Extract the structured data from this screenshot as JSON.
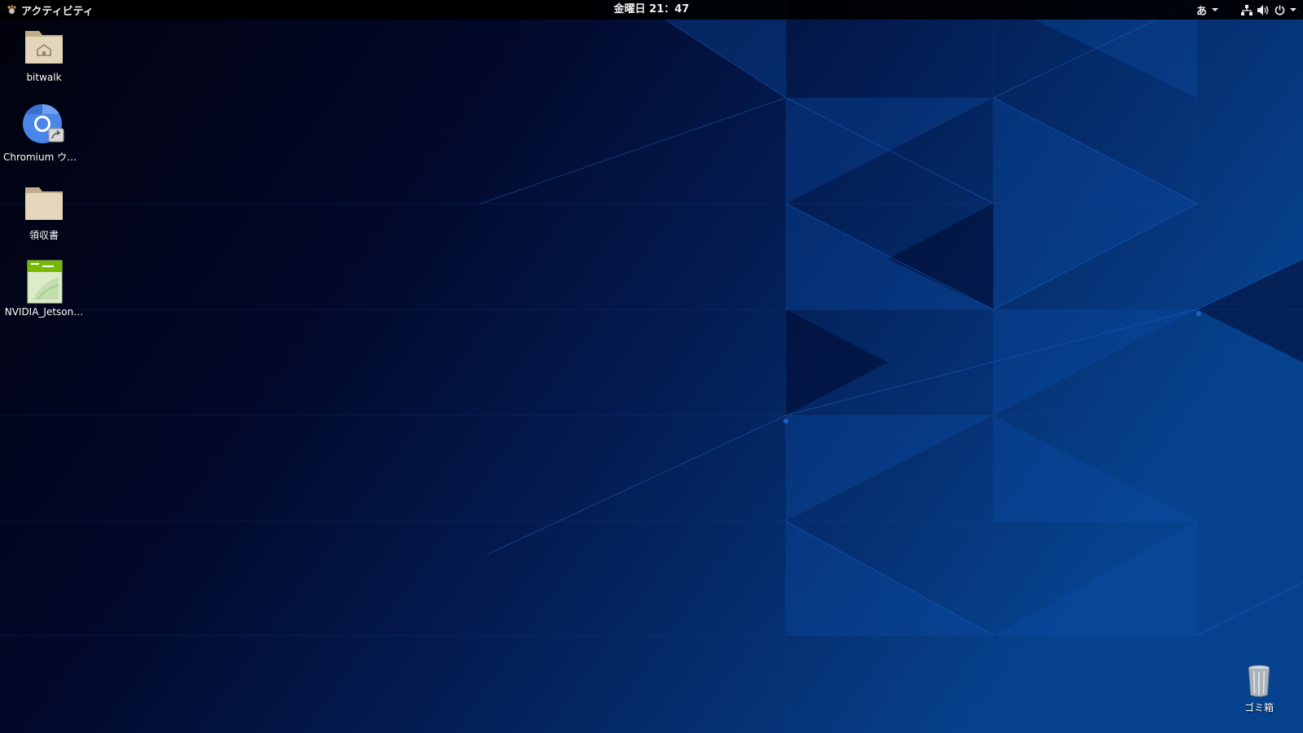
{
  "topbar": {
    "activities_label": "アクティビティ",
    "clock": "金曜日 21：47",
    "input_method": "あ",
    "icons": [
      "network-icon",
      "volume-icon",
      "power-icon"
    ]
  },
  "desktop": {
    "items": [
      {
        "label": "bitwalk",
        "icon": "home-folder-icon"
      },
      {
        "label": "Chromium ウェ…",
        "icon": "chromium-launcher-icon"
      },
      {
        "label": "領収書",
        "icon": "folder-icon"
      },
      {
        "label": "NVIDIA_Jetson…",
        "icon": "pdf-document-icon"
      }
    ],
    "trash": {
      "label": "ゴミ箱",
      "icon": "trash-icon"
    }
  },
  "colors": {
    "topbar_bg": "#000000",
    "topbar_text": "#eeeeec",
    "wallpaper_dark": "#01020d",
    "wallpaper_blue": "#063b86",
    "folder_tan": "#e0d2b4"
  }
}
